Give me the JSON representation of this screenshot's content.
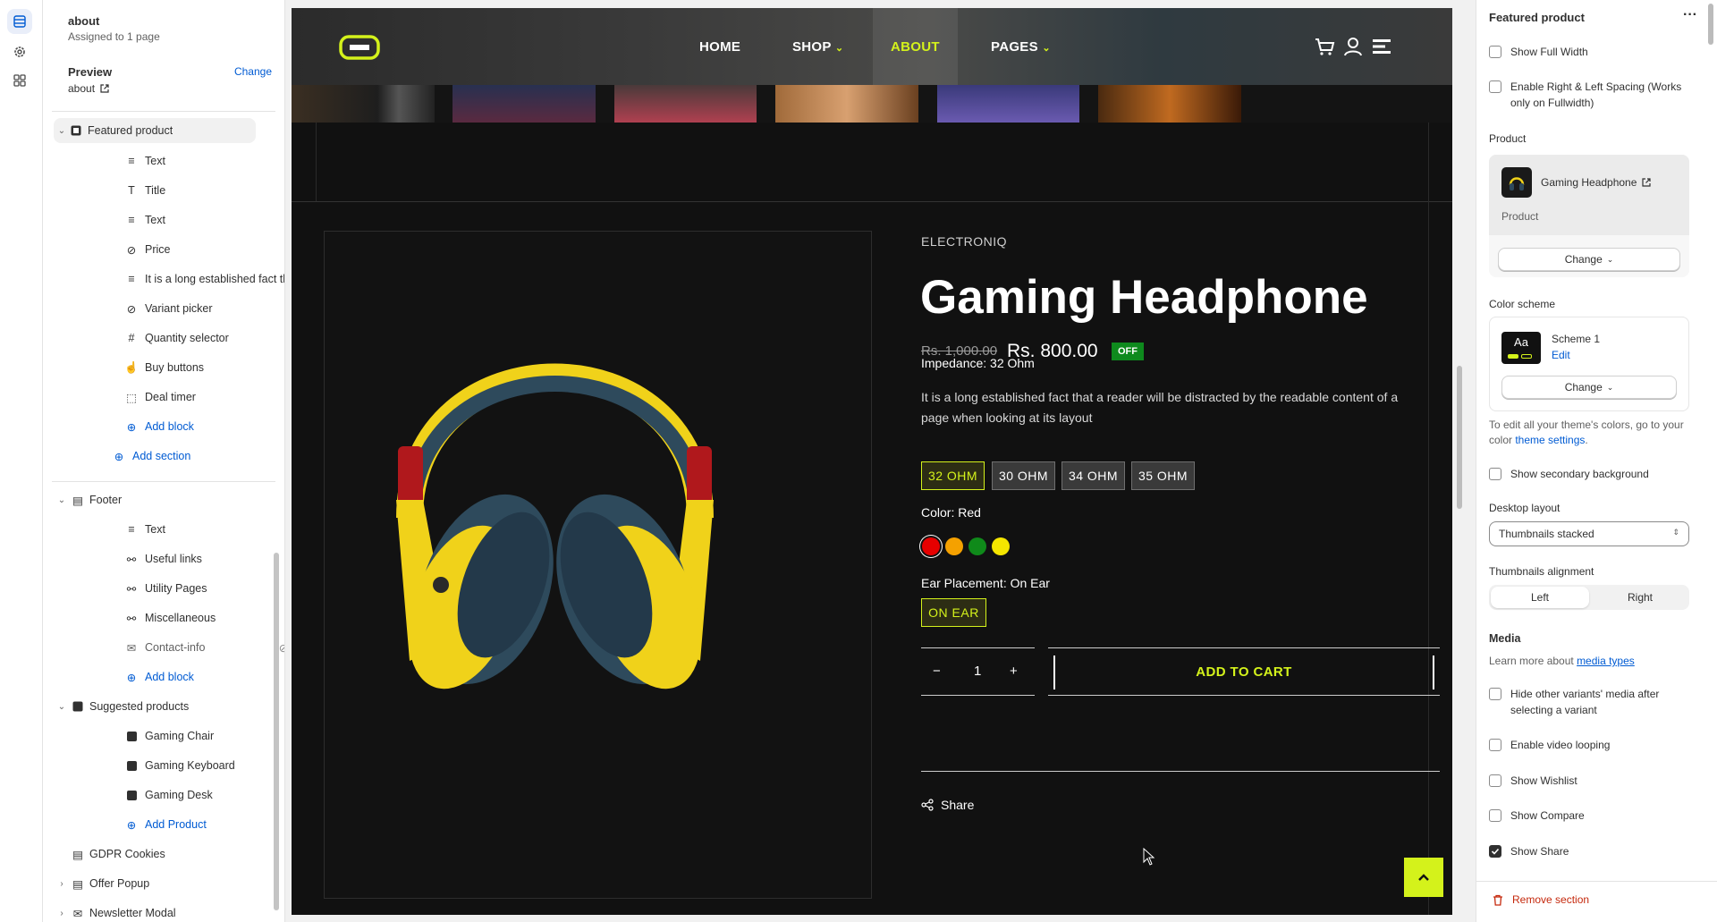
{
  "rail": {
    "items": [
      "sections-icon",
      "settings-icon",
      "apps-icon"
    ]
  },
  "left": {
    "page_name": "about",
    "assigned": "Assigned to 1 page",
    "preview_label": "Preview",
    "preview_change": "Change",
    "preview_value": "about",
    "tree": {
      "featured": "Featured product",
      "featured_blocks": [
        "Text",
        "Title",
        "Text",
        "Price",
        "It is a long established fact th...",
        "Variant picker",
        "Quantity selector",
        "Buy buttons",
        "Deal timer"
      ],
      "add_block": "Add block",
      "add_section": "Add section",
      "footer": "Footer",
      "footer_blocks": [
        "Text",
        "Useful links",
        "Utility Pages",
        "Miscellaneous",
        "Contact-info"
      ],
      "suggested": "Suggested products",
      "suggested_blocks": [
        "Gaming Chair",
        "Gaming Keyboard",
        "Gaming Desk"
      ],
      "add_product": "Add Product",
      "gdpr": "GDPR Cookies",
      "offer": "Offer Popup",
      "newsletter": "Newsletter Modal"
    }
  },
  "site": {
    "nav": [
      "HOME",
      "SHOP",
      "ABOUT",
      "PAGES"
    ],
    "active_nav": "ABOUT",
    "accent": "#d4f21b"
  },
  "product": {
    "vendor": "ELECTRONIQ",
    "title": "Gaming Headphone",
    "price_old": "Rs. 1,000.00",
    "price_new": "Rs. 800.00",
    "badge": "OFF",
    "description": "It is a long established fact that a reader will be distracted by the readable content of a page when looking at its layout",
    "impedance_label": "Impedance: 32 Ohm",
    "impedance_options": [
      "32 OHM",
      "30 OHM",
      "34 OHM",
      "35 OHM"
    ],
    "color_label": "Color: Red",
    "colors": [
      "#e60000",
      "#f5a100",
      "#0f8a1a",
      "#f5e600"
    ],
    "ear_label": "Ear Placement: On Ear",
    "ear_option": "ON EAR",
    "qty": "1",
    "qty_minus": "−",
    "qty_plus": "+",
    "add_to_cart": "ADD TO CART",
    "share": "Share"
  },
  "right": {
    "title": "Featured product",
    "more": "···",
    "show_full_width": "Show Full Width",
    "enable_spacing": "Enable Right & Left Spacing (Works only on Fullwidth)",
    "product_label": "Product",
    "product_name": "Gaming Headphone",
    "product_sub": "Product",
    "change": "Change",
    "color_scheme_label": "Color scheme",
    "scheme_name": "Scheme 1",
    "scheme_edit": "Edit",
    "scheme_aa": "Aa",
    "theme_note_pre": "To edit all your theme's colors, go to your color ",
    "theme_note_link": "theme settings",
    "theme_note_post": ".",
    "show_secondary_bg": "Show secondary background",
    "desktop_layout_label": "Desktop layout",
    "desktop_layout_value": "Thumbnails stacked",
    "thumb_align_label": "Thumbnails alignment",
    "thumb_align_left": "Left",
    "thumb_align_right": "Right",
    "media_label": "Media",
    "media_note_pre": "Learn more about ",
    "media_note_link": "media types",
    "hide_variants": "Hide other variants' media after selecting a variant",
    "video_looping": "Enable video looping",
    "show_wishlist": "Show Wishlist",
    "show_compare": "Show Compare",
    "show_share": "Show Share",
    "remove_section": "Remove section"
  }
}
